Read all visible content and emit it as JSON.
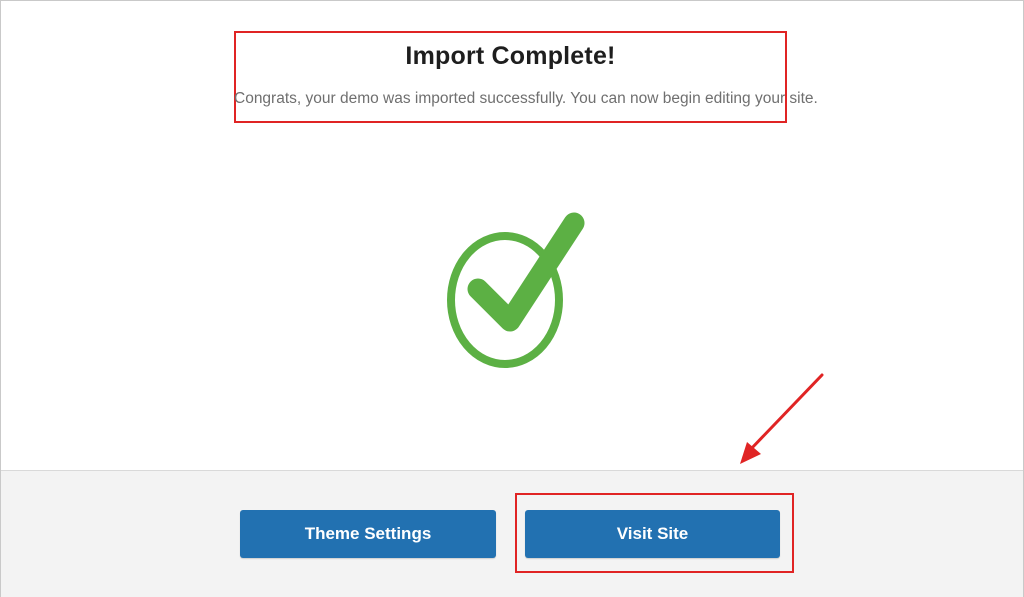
{
  "dialog": {
    "title": "Import Complete!",
    "message": "Congrats, your demo was imported successfully. You can now begin editing your site.",
    "status_icon": "success-check-icon"
  },
  "footer": {
    "theme_settings_label": "Theme Settings",
    "visit_site_label": "Visit Site"
  },
  "annotations": {
    "highlight_color": "#e02424",
    "arrow_icon": "red-annotation-arrow"
  },
  "colors": {
    "button": "#2271b1",
    "check": "#5cb044"
  }
}
